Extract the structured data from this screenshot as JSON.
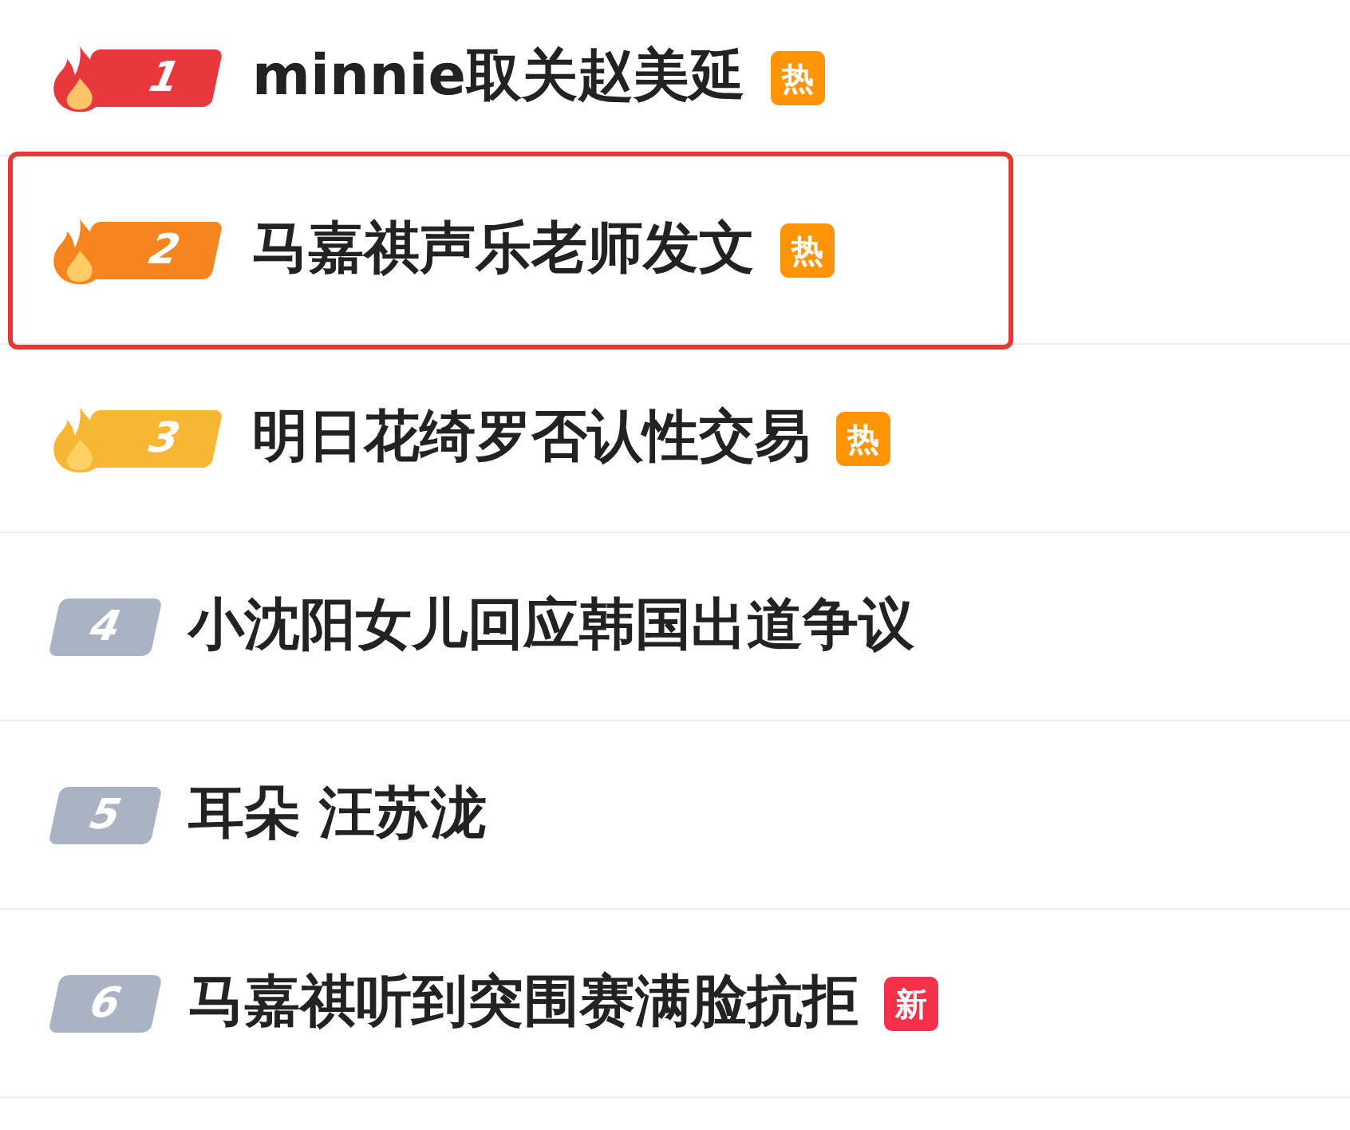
{
  "items": [
    {
      "rank": "1",
      "kind": "top",
      "color": "#e8383d",
      "title": "minnie取关赵美延",
      "tag": {
        "text": "热",
        "kind": "hot"
      },
      "highlighted": false
    },
    {
      "rank": "2",
      "kind": "top",
      "color": "#f6841f",
      "title": "马嘉祺声乐老师发文",
      "tag": {
        "text": "热",
        "kind": "hot"
      },
      "highlighted": true
    },
    {
      "rank": "3",
      "kind": "top",
      "color": "#f7b733",
      "title": "明日花绮罗否认性交易",
      "tag": {
        "text": "热",
        "kind": "hot"
      },
      "highlighted": false
    },
    {
      "rank": "4",
      "kind": "normal",
      "color": "#aab3c4",
      "title": "小沈阳女儿回应韩国出道争议",
      "highlighted": false
    },
    {
      "rank": "5",
      "kind": "normal",
      "color": "#aab3c4",
      "title": "耳朵 汪苏泷",
      "highlighted": false
    },
    {
      "rank": "6",
      "kind": "normal",
      "color": "#aab3c4",
      "title": "马嘉祺听到突围赛满脸抗拒",
      "tag": {
        "text": "新",
        "kind": "new"
      },
      "highlighted": false
    }
  ]
}
